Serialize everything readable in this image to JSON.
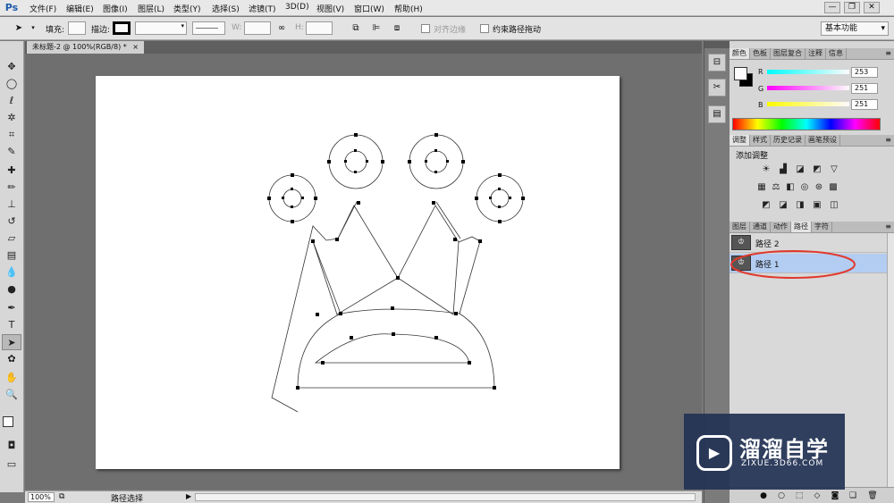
{
  "app": {
    "logo": "Ps"
  },
  "menu": [
    "文件(F)",
    "编辑(E)",
    "图像(I)",
    "图层(L)",
    "类型(Y)",
    "选择(S)",
    "滤镜(T)",
    "3D(D)",
    "视图(V)",
    "窗口(W)",
    "帮助(H)"
  ],
  "window_controls": [
    "—",
    "❐",
    "✕"
  ],
  "options": {
    "fill_label": "填充:",
    "stroke_label": "描边:",
    "w_label": "W:",
    "h_label": "H:",
    "align_edges_label": "对齐边缘",
    "constrain_path_label": "约束路径拖动",
    "workspace": "基本功能"
  },
  "document": {
    "tab_title": "未标题-2 @ 100%(RGB/8) *",
    "close_glyph": "×"
  },
  "status": {
    "zoom": "100%",
    "text": "路径选择"
  },
  "panels": {
    "color_tabs": [
      "颜色",
      "色板",
      "图层复合",
      "注释",
      "信息"
    ],
    "color": {
      "r_label": "R",
      "g_label": "G",
      "b_label": "B",
      "r": "253",
      "g": "251",
      "b": "251"
    },
    "adjust_tabs": [
      "调整",
      "样式",
      "历史记录",
      "画笔预设"
    ],
    "adjust_title": "添加调整",
    "layers_tabs": [
      "图层",
      "通道",
      "动作",
      "路径",
      "字符"
    ],
    "paths": [
      {
        "name": "路径 2"
      },
      {
        "name": "路径 1"
      }
    ]
  },
  "watermark": {
    "title": "溜溜自学",
    "subtitle": "ZIXUE.3D66.COM"
  },
  "colors": {
    "selection_highlight": "#b3ccf2",
    "annotation_ellipse": "#e03a2e",
    "swatch_fg": "#fdfbfb",
    "swatch_bg": "#000000"
  }
}
